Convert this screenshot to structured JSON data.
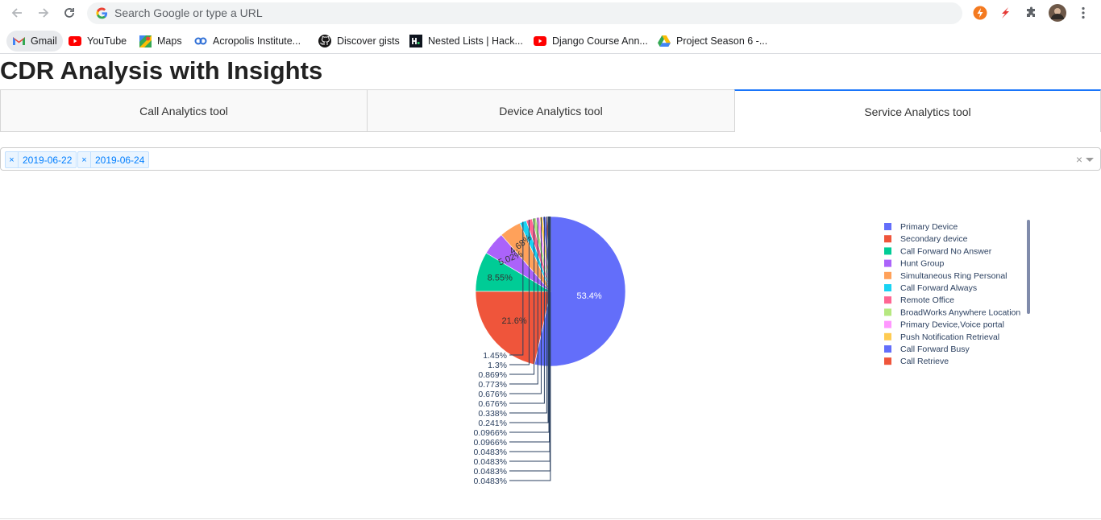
{
  "browser": {
    "omnibox_placeholder": "Search Google or type a URL",
    "bookmarks": [
      {
        "label": "Gmail",
        "icon": "gmail-icon"
      },
      {
        "label": "YouTube",
        "icon": "youtube-icon"
      },
      {
        "label": "Maps",
        "icon": "maps-icon"
      },
      {
        "label": "Acropolis Institute...",
        "icon": "acropolis-icon"
      },
      {
        "label": "Discover gists",
        "icon": "github-icon"
      },
      {
        "label": "Nested Lists | Hack...",
        "icon": "hackerrank-icon"
      },
      {
        "label": "Django Course Ann...",
        "icon": "youtube-icon"
      },
      {
        "label": "Project Season 6 -...",
        "icon": "drive-icon"
      }
    ]
  },
  "page": {
    "title": "CDR Analysis with Insights",
    "tabs": [
      {
        "label": "Call Analytics tool",
        "active": false
      },
      {
        "label": "Device Analytics tool",
        "active": false
      },
      {
        "label": "Service Analytics tool",
        "active": true
      }
    ],
    "date_filter": {
      "selected": [
        "2019-06-22",
        "2019-06-24"
      ],
      "remove_symbol": "×",
      "clear_symbol": "×"
    }
  },
  "chart_data": {
    "type": "pie",
    "slices": [
      {
        "label": "Primary Device",
        "percent": 53.4,
        "text": "53.4%",
        "color": "#636efa"
      },
      {
        "label": "Secondary device",
        "percent": 21.6,
        "text": "21.6%",
        "color": "#ef553b"
      },
      {
        "label": "Call Forward No Answer",
        "percent": 8.55,
        "text": "8.55%",
        "color": "#00cc96"
      },
      {
        "label": "Hunt Group",
        "percent": 5.02,
        "text": "5.02%",
        "color": "#ab63fa"
      },
      {
        "label": "Simultaneous Ring Personal",
        "percent": 4.68,
        "text": "4.68%",
        "color": "#ffa15a"
      },
      {
        "label": "Call Forward Always",
        "percent": 1.45,
        "text": "1.45%",
        "color": "#19d3f3"
      },
      {
        "label": "Remote Office",
        "percent": 1.3,
        "text": "1.3%",
        "color": "#ff6692"
      },
      {
        "label": "BroadWorks Anywhere Location",
        "percent": 0.869,
        "text": "0.869%",
        "color": "#b6e880"
      },
      {
        "label": "Primary Device,Voice portal",
        "percent": 0.773,
        "text": "0.773%",
        "color": "#ff97ff"
      },
      {
        "label": "Push Notification Retrieval",
        "percent": 0.676,
        "text": "0.676%",
        "color": "#fecb52"
      },
      {
        "label": "Call Forward Busy",
        "percent": 0.676,
        "text": "0.676%",
        "color": "#636efa"
      },
      {
        "label": "Call Retrieve",
        "percent": 0.338,
        "text": "0.338%",
        "color": "#ef553b"
      },
      {
        "label": "",
        "percent": 0.241,
        "text": "0.241%",
        "color": "#00cc96"
      },
      {
        "label": "",
        "percent": 0.0966,
        "text": "0.0966%",
        "color": "#ab63fa"
      },
      {
        "label": "",
        "percent": 0.0966,
        "text": "0.0966%",
        "color": "#ffa15a"
      },
      {
        "label": "",
        "percent": 0.0483,
        "text": "0.0483%",
        "color": "#19d3f3"
      },
      {
        "label": "",
        "percent": 0.0483,
        "text": "0.0483%",
        "color": "#ff6692"
      },
      {
        "label": "",
        "percent": 0.0483,
        "text": "0.0483%",
        "color": "#b6e880"
      },
      {
        "label": "",
        "percent": 0.0483,
        "text": "0.0483%",
        "color": "#ff97ff"
      }
    ],
    "legend_position": "right",
    "legend_visible_count": 12
  }
}
